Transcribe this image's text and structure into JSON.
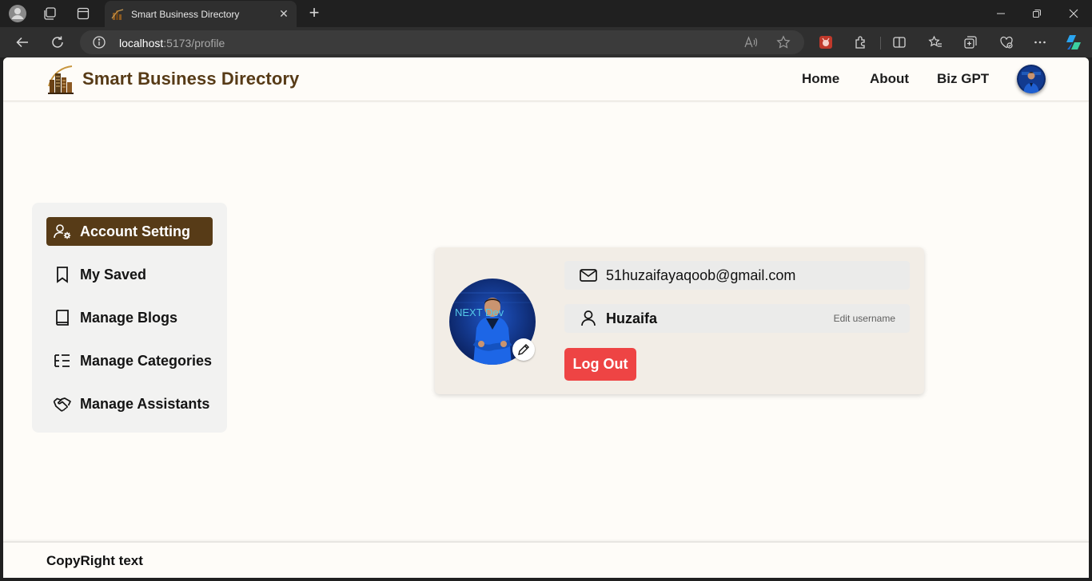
{
  "browser": {
    "tab_title": "Smart Business Directory",
    "url_host": "localhost",
    "url_rest": ":5173/profile"
  },
  "site": {
    "brand": "Smart Business Directory",
    "nav": [
      "Home",
      "About",
      "Biz GPT"
    ],
    "colors": {
      "brand": "#573b17",
      "background": "#fefcf8",
      "logout": "#ee4444"
    }
  },
  "sidebar": {
    "items": [
      {
        "label": "Account Setting",
        "icon": "user-gear-icon",
        "active": true
      },
      {
        "label": "My Saved",
        "icon": "bookmark-icon",
        "active": false
      },
      {
        "label": "Manage Blogs",
        "icon": "book-icon",
        "active": false
      },
      {
        "label": "Manage Categories",
        "icon": "list-tree-icon",
        "active": false
      },
      {
        "label": "Manage Assistants",
        "icon": "handshake-icon",
        "active": false
      }
    ]
  },
  "profile": {
    "email": "51huzaifayaqoob@gmail.com",
    "username": "Huzaifa",
    "edit_username_label": "Edit username",
    "logout_label": "Log Out",
    "photo_caption": "NEXT Dev"
  },
  "footer": {
    "text": "CopyRight text"
  }
}
